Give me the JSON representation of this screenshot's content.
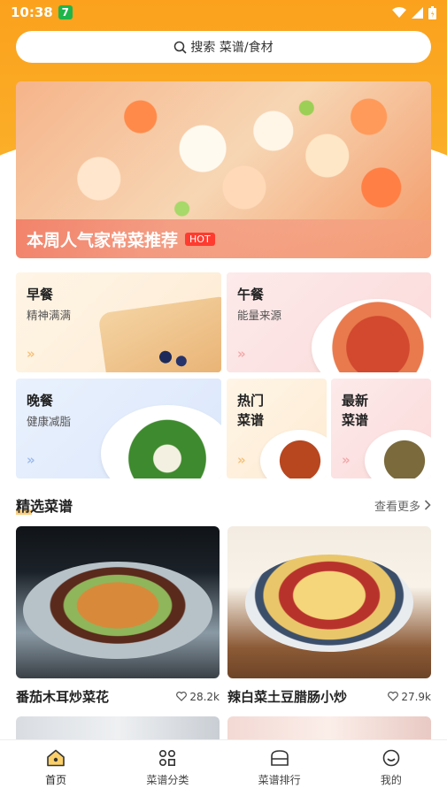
{
  "status": {
    "time": "10:38",
    "badge": "7"
  },
  "search": {
    "placeholder": "搜索 菜谱/食材"
  },
  "banner": {
    "title": "本周人气家常菜推荐",
    "badge": "HOT"
  },
  "categories": [
    {
      "title": "早餐",
      "subtitle": "精神满满",
      "arrow": "»"
    },
    {
      "title": "午餐",
      "subtitle": "能量来源",
      "arrow": "»"
    },
    {
      "title": "晚餐",
      "subtitle": "健康减脂",
      "arrow": "»"
    },
    {
      "title": "热门\n菜谱",
      "arrow": "»"
    },
    {
      "title": "最新\n菜谱",
      "arrow": "»"
    }
  ],
  "section": {
    "title": "精选菜谱",
    "more": "查看更多"
  },
  "recipes": [
    {
      "name": "番茄木耳炒菜花",
      "likes": "28.2k"
    },
    {
      "name": "辣白菜土豆腊肠小炒",
      "likes": "27.9k"
    }
  ],
  "tabs": [
    {
      "label": "首页",
      "icon": "home-icon",
      "active": true
    },
    {
      "label": "菜谱分类",
      "icon": "grid-icon"
    },
    {
      "label": "菜谱排行",
      "icon": "ranking-icon"
    },
    {
      "label": "我的",
      "icon": "smile-icon"
    }
  ],
  "colors": {
    "accent": "#fba11d",
    "hot": "#ff3b2f",
    "active_tab": "#fbb02a"
  }
}
